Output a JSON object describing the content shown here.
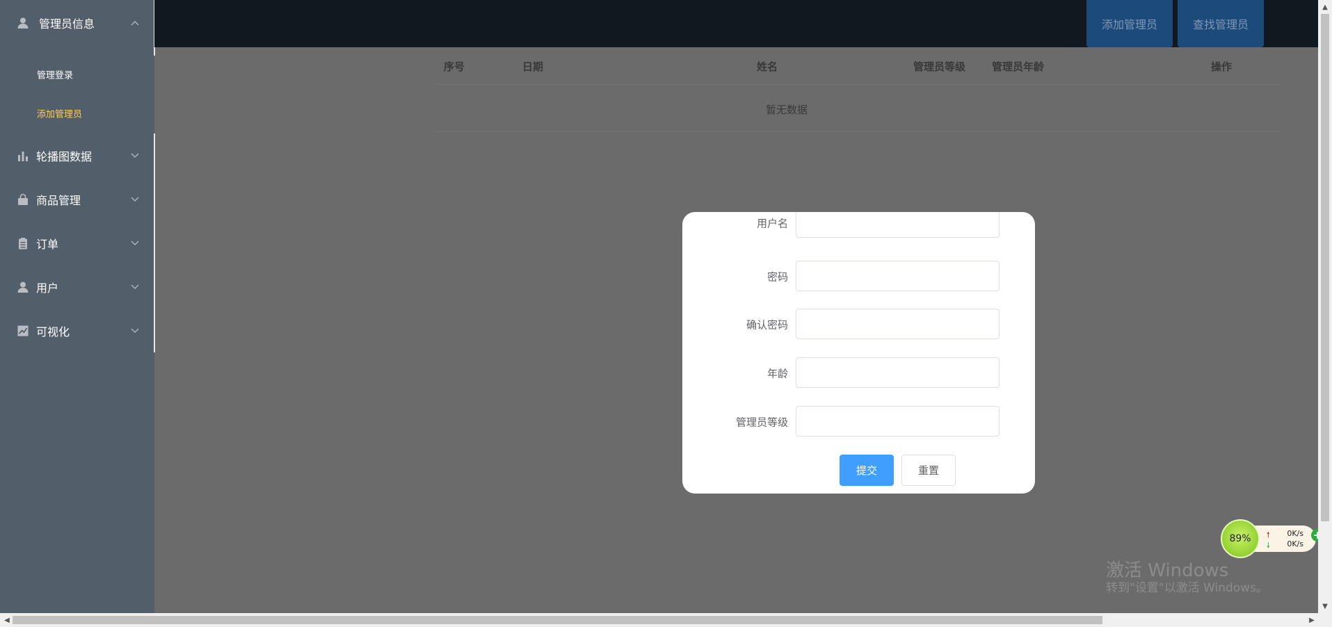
{
  "sidebar": {
    "groups": [
      {
        "label": "管理员信息",
        "icon": "user-icon",
        "expanded": true,
        "children": [
          {
            "label": "管理登录",
            "active": false
          },
          {
            "label": "添加管理员",
            "active": true
          }
        ]
      },
      {
        "label": "轮播图数据",
        "icon": "bar-chart-icon"
      },
      {
        "label": "商品管理",
        "icon": "shopping-bag-icon"
      },
      {
        "label": "订单",
        "icon": "clipboard-icon"
      },
      {
        "label": "用户",
        "icon": "user-icon"
      },
      {
        "label": "可视化",
        "icon": "line-chart-icon"
      }
    ]
  },
  "header": {
    "add_admin_label": "添加管理员",
    "find_admin_label": "查找管理员"
  },
  "table": {
    "columns": [
      "序号",
      "日期",
      "姓名",
      "管理员等级",
      "管理员年龄",
      "操作"
    ],
    "empty_text": "暂无数据"
  },
  "dialog": {
    "fields": [
      {
        "label": "用户名",
        "value": ""
      },
      {
        "label": "密码",
        "value": ""
      },
      {
        "label": "确认密码",
        "value": ""
      },
      {
        "label": "年龄",
        "value": ""
      },
      {
        "label": "管理员等级",
        "value": ""
      }
    ],
    "submit_label": "提交",
    "reset_label": "重置"
  },
  "widget": {
    "percent": "89%",
    "upload": "0K/s",
    "download": "0K/s"
  },
  "watermark": {
    "line1": "激活 Windows",
    "line2": "转到\"设置\"以激活 Windows。"
  },
  "colors": {
    "sidebar_bg": "#535e6b",
    "active_submenu": "#ffd04b",
    "primary": "#409eff",
    "topbar_bg": "#111820",
    "overlay_bg": "#6b6b6b"
  }
}
